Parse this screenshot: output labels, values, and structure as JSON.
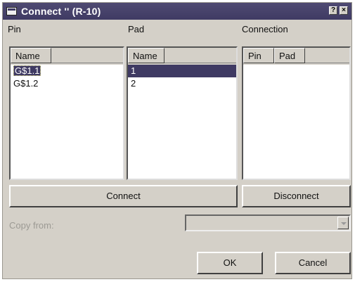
{
  "window": {
    "title": "Connect '' (R-10)"
  },
  "labels": {
    "pin": "Pin",
    "pad": "Pad",
    "connection": "Connection",
    "copy_from": "Copy from:"
  },
  "pin_list": {
    "header": "Name",
    "items": [
      "G$1.1",
      "G$1.2"
    ]
  },
  "pad_list": {
    "header": "Name",
    "items": [
      "1",
      "2"
    ]
  },
  "connection_list": {
    "headers": [
      "Pin",
      "Pad"
    ]
  },
  "buttons": {
    "connect": "Connect",
    "disconnect": "Disconnect",
    "ok": "OK",
    "cancel": "Cancel"
  },
  "copy_from": {
    "value": ""
  },
  "colors": {
    "titlebar": "#3f3a63",
    "selection": "#3f3a63",
    "face": "#d4d0c8"
  }
}
